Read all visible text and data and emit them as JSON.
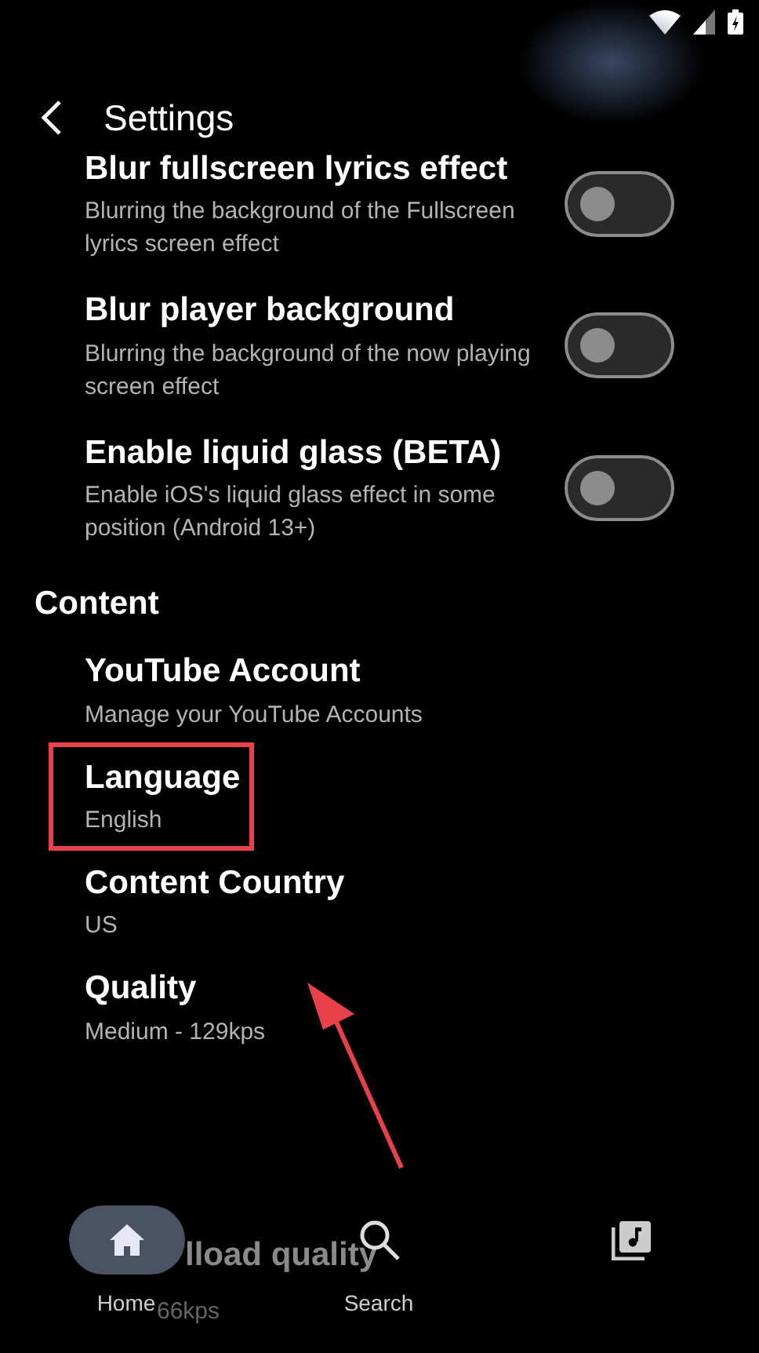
{
  "header": {
    "title": "Settings"
  },
  "sections": [
    {
      "items": [
        {
          "kind": "toggle",
          "title": "Blur fullscreen lyrics effect",
          "subtitle": "Blurring the background of the Fullscreen lyrics screen effect",
          "on": false
        },
        {
          "kind": "toggle",
          "title": "Blur player background",
          "subtitle": "Blurring the background of the now playing screen effect",
          "on": false
        },
        {
          "kind": "toggle",
          "title": "Enable liquid glass (BETA)",
          "subtitle": "Enable iOS's liquid glass effect in some position (Android 13+)",
          "on": false
        }
      ]
    },
    {
      "title": "Content",
      "items": [
        {
          "kind": "link",
          "title": "YouTube Account",
          "subtitle": "Manage your YouTube Accounts"
        },
        {
          "kind": "link",
          "title": "Language",
          "subtitle": "English",
          "highlighted": true
        },
        {
          "kind": "link",
          "title": "Content Country",
          "subtitle": "US"
        },
        {
          "kind": "link",
          "title": "Quality",
          "subtitle": "Medium - 129kps"
        }
      ]
    }
  ],
  "faded_item": {
    "title": "lload quality",
    "subtitle": "66kps"
  },
  "nav": [
    {
      "kind": "home",
      "label": "Home",
      "selected": true
    },
    {
      "kind": "search",
      "label": "Search",
      "selected": false
    },
    {
      "kind": "library",
      "selected": false
    }
  ]
}
